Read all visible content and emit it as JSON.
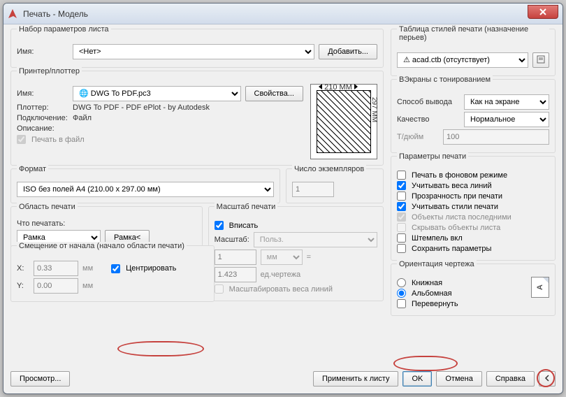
{
  "window": {
    "title": "Печать - Модель",
    "close_x": "X"
  },
  "page_setup": {
    "legend": "Набор параметров листа",
    "name_label": "Имя:",
    "name_value": "<Нет>",
    "add_button": "Добавить..."
  },
  "printer": {
    "legend": "Принтер/плоттер",
    "name_label": "Имя:",
    "name_value": "DWG To PDF.pc3",
    "properties_button": "Свойства...",
    "plotter_label": "Плоттер:",
    "plotter_value": "DWG To PDF - PDF ePlot - by Autodesk",
    "connect_label": "Подключение:",
    "connect_value": "Файл",
    "desc_label": "Описание:",
    "print_to_file": "Печать в файл",
    "dim_w": "210 MM",
    "dim_h": "297 MM"
  },
  "format": {
    "legend": "Формат",
    "value": "ISO без полей A4 (210.00 x 297.00 мм)",
    "copies_legend": "Число экземпляров",
    "copies_value": "1"
  },
  "area": {
    "legend": "Область печати",
    "what_label": "Что печатать:",
    "what_value": "Рамка",
    "frame_button": "Рамка<"
  },
  "offset": {
    "legend": "Смещение от начала (начало области печати)",
    "x_label": "X:",
    "x_value": "0.33",
    "x_unit": "мм",
    "y_label": "Y:",
    "y_value": "0.00",
    "y_unit": "мм",
    "center_label": "Центрировать"
  },
  "scale": {
    "legend": "Масштаб печати",
    "fit_label": "Вписать",
    "scale_label": "Масштаб:",
    "scale_value": "Польз.",
    "num_value": "1",
    "num_unit": "мм",
    "eq": "=",
    "den_value": "1.423",
    "den_unit": "ед.чертежа",
    "weights_label": "Масштабировать веса линий"
  },
  "plot_style": {
    "legend": "Таблица стилей печати (назначение перьев)",
    "value": "acad.ctb (отсутствует)"
  },
  "shade": {
    "legend": "ВЭкраны с тонированием",
    "out_label": "Способ вывода",
    "out_value": "Как на экране",
    "qual_label": "Качество",
    "qual_value": "Нормальное",
    "dpi_label": "Т/дюйм",
    "dpi_value": "100"
  },
  "options": {
    "legend": "Параметры печати",
    "background": "Печать в фоновом режиме",
    "lineweights": "Учитывать веса линий",
    "transparency": "Прозрачность при печати",
    "plot_styles": "Учитывать стили печати",
    "paperspace_last": "Объекты листа последними",
    "hide_paperspace": "Скрывать объекты листа",
    "stamp": "Штемпель вкл",
    "save_params": "Сохранить параметры"
  },
  "orient": {
    "legend": "Ориентация чертежа",
    "portrait": "Книжная",
    "landscape": "Альбомная",
    "upside_down": "Перевернуть",
    "orient_letter": "A"
  },
  "footer": {
    "preview": "Просмотр...",
    "apply": "Применить к листу",
    "ok": "OK",
    "cancel": "Отмена",
    "help": "Справка"
  }
}
